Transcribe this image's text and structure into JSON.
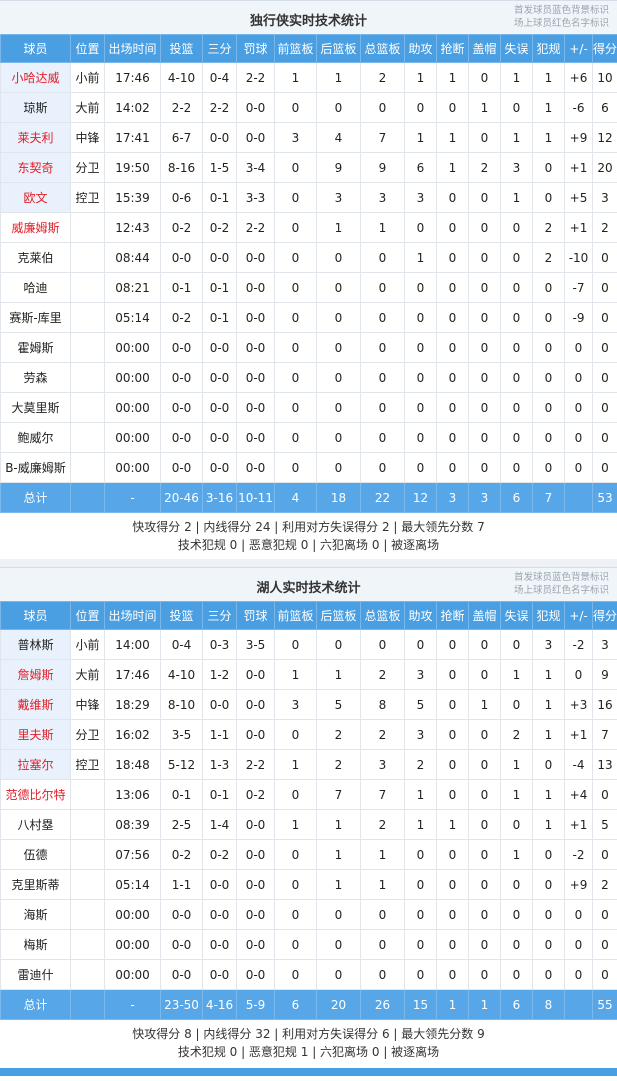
{
  "legend": [
    "首发球员蓝色背景标识",
    "场上球员红色名字标识"
  ],
  "columns": [
    "球员",
    "位置",
    "出场时间",
    "投篮",
    "三分",
    "罚球",
    "前篮板",
    "后篮板",
    "总篮板",
    "助攻",
    "抢断",
    "盖帽",
    "失误",
    "犯规",
    "+/-",
    "得分"
  ],
  "teams": [
    {
      "title": "独行侠实时技术统计",
      "rows": [
        {
          "starter": true,
          "oncourt": true,
          "cells": [
            "小哈达威",
            "小前",
            "17:46",
            "4-10",
            "0-4",
            "2-2",
            "1",
            "1",
            "2",
            "1",
            "1",
            "0",
            "1",
            "1",
            "+6",
            "10"
          ]
        },
        {
          "starter": true,
          "oncourt": false,
          "cells": [
            "琼斯",
            "大前",
            "14:02",
            "2-2",
            "2-2",
            "0-0",
            "0",
            "0",
            "0",
            "0",
            "0",
            "1",
            "0",
            "1",
            "-6",
            "6"
          ]
        },
        {
          "starter": true,
          "oncourt": true,
          "cells": [
            "莱夫利",
            "中锋",
            "17:41",
            "6-7",
            "0-0",
            "0-0",
            "3",
            "4",
            "7",
            "1",
            "1",
            "0",
            "1",
            "1",
            "+9",
            "12"
          ]
        },
        {
          "starter": true,
          "oncourt": true,
          "cells": [
            "东契奇",
            "分卫",
            "19:50",
            "8-16",
            "1-5",
            "3-4",
            "0",
            "9",
            "9",
            "6",
            "1",
            "2",
            "3",
            "0",
            "+1",
            "20"
          ]
        },
        {
          "starter": true,
          "oncourt": true,
          "cells": [
            "欧文",
            "控卫",
            "15:39",
            "0-6",
            "0-1",
            "3-3",
            "0",
            "3",
            "3",
            "3",
            "0",
            "0",
            "1",
            "0",
            "+5",
            "3"
          ]
        },
        {
          "starter": false,
          "oncourt": true,
          "cells": [
            "威廉姆斯",
            "",
            "12:43",
            "0-2",
            "0-2",
            "2-2",
            "0",
            "1",
            "1",
            "0",
            "0",
            "0",
            "0",
            "2",
            "+1",
            "2"
          ]
        },
        {
          "starter": false,
          "oncourt": false,
          "cells": [
            "克莱伯",
            "",
            "08:44",
            "0-0",
            "0-0",
            "0-0",
            "0",
            "0",
            "0",
            "1",
            "0",
            "0",
            "0",
            "2",
            "-10",
            "0"
          ]
        },
        {
          "starter": false,
          "oncourt": false,
          "cells": [
            "哈迪",
            "",
            "08:21",
            "0-1",
            "0-1",
            "0-0",
            "0",
            "0",
            "0",
            "0",
            "0",
            "0",
            "0",
            "0",
            "-7",
            "0"
          ]
        },
        {
          "starter": false,
          "oncourt": false,
          "cells": [
            "赛斯-库里",
            "",
            "05:14",
            "0-2",
            "0-1",
            "0-0",
            "0",
            "0",
            "0",
            "0",
            "0",
            "0",
            "0",
            "0",
            "-9",
            "0"
          ]
        },
        {
          "starter": false,
          "oncourt": false,
          "cells": [
            "霍姆斯",
            "",
            "00:00",
            "0-0",
            "0-0",
            "0-0",
            "0",
            "0",
            "0",
            "0",
            "0",
            "0",
            "0",
            "0",
            "0",
            "0"
          ]
        },
        {
          "starter": false,
          "oncourt": false,
          "cells": [
            "劳森",
            "",
            "00:00",
            "0-0",
            "0-0",
            "0-0",
            "0",
            "0",
            "0",
            "0",
            "0",
            "0",
            "0",
            "0",
            "0",
            "0"
          ]
        },
        {
          "starter": false,
          "oncourt": false,
          "cells": [
            "大莫里斯",
            "",
            "00:00",
            "0-0",
            "0-0",
            "0-0",
            "0",
            "0",
            "0",
            "0",
            "0",
            "0",
            "0",
            "0",
            "0",
            "0"
          ]
        },
        {
          "starter": false,
          "oncourt": false,
          "cells": [
            "鲍威尔",
            "",
            "00:00",
            "0-0",
            "0-0",
            "0-0",
            "0",
            "0",
            "0",
            "0",
            "0",
            "0",
            "0",
            "0",
            "0",
            "0"
          ]
        },
        {
          "starter": false,
          "oncourt": false,
          "cells": [
            "B-威廉姆斯",
            "",
            "00:00",
            "0-0",
            "0-0",
            "0-0",
            "0",
            "0",
            "0",
            "0",
            "0",
            "0",
            "0",
            "0",
            "0",
            "0"
          ]
        }
      ],
      "total": [
        "总计",
        "",
        "-",
        "20-46",
        "3-16",
        "10-11",
        "4",
        "18",
        "22",
        "12",
        "3",
        "3",
        "6",
        "7",
        "",
        "53"
      ],
      "summary": [
        "快攻得分 2 | 内线得分 24 | 利用对方失误得分 2 | 最大领先分数 7",
        "技术犯规 0 | 恶意犯规 0 | 六犯离场 0 | 被逐离场"
      ]
    },
    {
      "title": "湖人实时技术统计",
      "rows": [
        {
          "starter": true,
          "oncourt": false,
          "cells": [
            "普林斯",
            "小前",
            "14:00",
            "0-4",
            "0-3",
            "3-5",
            "0",
            "0",
            "0",
            "0",
            "0",
            "0",
            "0",
            "3",
            "-2",
            "3"
          ]
        },
        {
          "starter": true,
          "oncourt": true,
          "cells": [
            "詹姆斯",
            "大前",
            "17:46",
            "4-10",
            "1-2",
            "0-0",
            "1",
            "1",
            "2",
            "3",
            "0",
            "0",
            "1",
            "1",
            "0",
            "9"
          ]
        },
        {
          "starter": true,
          "oncourt": true,
          "cells": [
            "戴维斯",
            "中锋",
            "18:29",
            "8-10",
            "0-0",
            "0-0",
            "3",
            "5",
            "8",
            "5",
            "0",
            "1",
            "0",
            "1",
            "+3",
            "16"
          ]
        },
        {
          "starter": true,
          "oncourt": true,
          "cells": [
            "里夫斯",
            "分卫",
            "16:02",
            "3-5",
            "1-1",
            "0-0",
            "0",
            "2",
            "2",
            "3",
            "0",
            "0",
            "2",
            "1",
            "+1",
            "7"
          ]
        },
        {
          "starter": true,
          "oncourt": true,
          "cells": [
            "拉塞尔",
            "控卫",
            "18:48",
            "5-12",
            "1-3",
            "2-2",
            "1",
            "2",
            "3",
            "2",
            "0",
            "0",
            "1",
            "0",
            "-4",
            "13"
          ]
        },
        {
          "starter": false,
          "oncourt": true,
          "cells": [
            "范德比尔特",
            "",
            "13:06",
            "0-1",
            "0-1",
            "0-2",
            "0",
            "7",
            "7",
            "1",
            "0",
            "0",
            "1",
            "1",
            "+4",
            "0"
          ]
        },
        {
          "starter": false,
          "oncourt": false,
          "cells": [
            "八村塁",
            "",
            "08:39",
            "2-5",
            "1-4",
            "0-0",
            "1",
            "1",
            "2",
            "1",
            "1",
            "0",
            "0",
            "1",
            "+1",
            "5"
          ]
        },
        {
          "starter": false,
          "oncourt": false,
          "cells": [
            "伍德",
            "",
            "07:56",
            "0-2",
            "0-2",
            "0-0",
            "0",
            "1",
            "1",
            "0",
            "0",
            "0",
            "1",
            "0",
            "-2",
            "0"
          ]
        },
        {
          "starter": false,
          "oncourt": false,
          "cells": [
            "克里斯蒂",
            "",
            "05:14",
            "1-1",
            "0-0",
            "0-0",
            "0",
            "1",
            "1",
            "0",
            "0",
            "0",
            "0",
            "0",
            "+9",
            "2"
          ]
        },
        {
          "starter": false,
          "oncourt": false,
          "cells": [
            "海斯",
            "",
            "00:00",
            "0-0",
            "0-0",
            "0-0",
            "0",
            "0",
            "0",
            "0",
            "0",
            "0",
            "0",
            "0",
            "0",
            "0"
          ]
        },
        {
          "starter": false,
          "oncourt": false,
          "cells": [
            "梅斯",
            "",
            "00:00",
            "0-0",
            "0-0",
            "0-0",
            "0",
            "0",
            "0",
            "0",
            "0",
            "0",
            "0",
            "0",
            "0",
            "0"
          ]
        },
        {
          "starter": false,
          "oncourt": false,
          "cells": [
            "雷迪什",
            "",
            "00:00",
            "0-0",
            "0-0",
            "0-0",
            "0",
            "0",
            "0",
            "0",
            "0",
            "0",
            "0",
            "0",
            "0",
            "0"
          ]
        }
      ],
      "total": [
        "总计",
        "",
        "-",
        "23-50",
        "4-16",
        "5-9",
        "6",
        "20",
        "26",
        "15",
        "1",
        "1",
        "6",
        "8",
        "",
        "55"
      ],
      "summary": [
        "快攻得分 8 | 内线得分 32 | 利用对方失误得分 6 | 最大领先分数 9",
        "技术犯规 0 | 恶意犯规 1 | 六犯离场 0 | 被逐离场"
      ]
    }
  ]
}
